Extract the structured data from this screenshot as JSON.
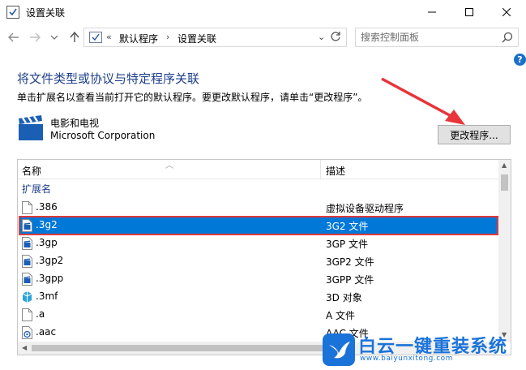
{
  "window": {
    "title": "设置关联"
  },
  "address": {
    "overflow": "«",
    "crumbs": [
      "默认程序",
      "设置关联"
    ]
  },
  "search": {
    "placeholder": "搜索控制面板"
  },
  "help_icon": "?",
  "page": {
    "heading": "将文件类型或协议与特定程序关联",
    "instruction": "单击扩展名以查看当前打开它的默认程序。要更改默认程序，请单击“更改程序”。"
  },
  "app": {
    "name": "电影和电视",
    "vendor": "Microsoft Corporation",
    "change_button": "更改程序..."
  },
  "list": {
    "columns": {
      "name": "名称",
      "description": "描述"
    },
    "group": "扩展名",
    "rows": [
      {
        "ext": ".386",
        "desc": "虚拟设备驱动程序",
        "icon": "blank-file-icon"
      },
      {
        "ext": ".3g2",
        "desc": "3G2 文件",
        "icon": "video-file-icon",
        "selected": true
      },
      {
        "ext": ".3gp",
        "desc": "3GP 文件",
        "icon": "video-file-icon"
      },
      {
        "ext": ".3gp2",
        "desc": "3GP2 文件",
        "icon": "video-file-icon"
      },
      {
        "ext": ".3gpp",
        "desc": "3GPP 文件",
        "icon": "video-file-icon"
      },
      {
        "ext": ".3mf",
        "desc": "3D 对象",
        "icon": "3d-object-icon"
      },
      {
        "ext": ".a",
        "desc": "A 文件",
        "icon": "blank-file-icon"
      },
      {
        "ext": ".aac",
        "desc": "AAC 文件",
        "icon": "audio-file-icon"
      }
    ]
  },
  "watermark": {
    "text": "白云一键重装系统",
    "url": "www.baiyunxitong.com"
  },
  "colors": {
    "selection": "#0078d7",
    "heading": "#1e3f8a",
    "highlight_border": "#e03a3a",
    "watermark": "#1a73d9"
  }
}
